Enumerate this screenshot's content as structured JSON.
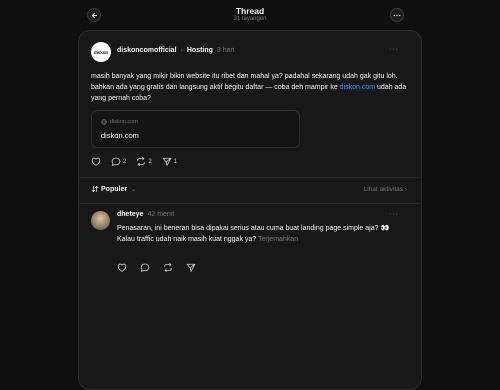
{
  "header": {
    "title": "Thread",
    "views": "31 tayangen"
  },
  "post": {
    "avatar_text": "diskon",
    "username": "diskoncomofficial",
    "topic": "Hosting",
    "time": "3 hari",
    "text_before_link": "masih banyak yang mikir bikin website itu ribet dan mahal ya? padahal sekarang udah gak gitu loh. bahkan ada yang gratis dan langsung aktif begitu daftar — coba deh mampir ke ",
    "link": "diskon.com",
    "text_after_link": " udah ada yang pernah coba?",
    "preview": {
      "domain": "diskon.com",
      "title": "diskon.com"
    },
    "counts": {
      "like": "",
      "reply": "2",
      "repost": "2",
      "share": "1"
    }
  },
  "sort": {
    "label": "Populer",
    "activity": "Lihat aktivitas"
  },
  "reply": {
    "username": "dheteye",
    "time": "42 menit",
    "line1": "Penasaran, ini beneran bisa dipakai serius atau cuma buat landing page simple aja? 👀",
    "line2": "Kalau traffic udah naik masih kuat nggak ya?",
    "translate": "Terjemahkan"
  }
}
